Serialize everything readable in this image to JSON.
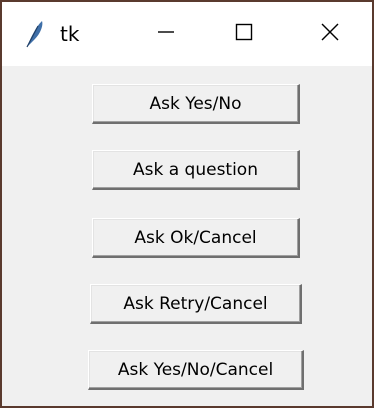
{
  "window": {
    "title": "tk",
    "app_icon": "feather-icon",
    "controls": {
      "minimize_icon": "minimize-icon",
      "maximize_icon": "maximize-icon",
      "close_icon": "close-icon"
    }
  },
  "buttons": [
    {
      "label": "Ask Yes/No"
    },
    {
      "label": "Ask a question"
    },
    {
      "label": "Ask Ok/Cancel"
    },
    {
      "label": "Ask Retry/Cancel"
    },
    {
      "label": "Ask Yes/No/Cancel"
    }
  ],
  "colors": {
    "window_bg": "#f0f0f0",
    "titlebar_bg": "#ffffff",
    "window_border": "#5a3a2e",
    "icon_blue": "#3f6fa8"
  }
}
